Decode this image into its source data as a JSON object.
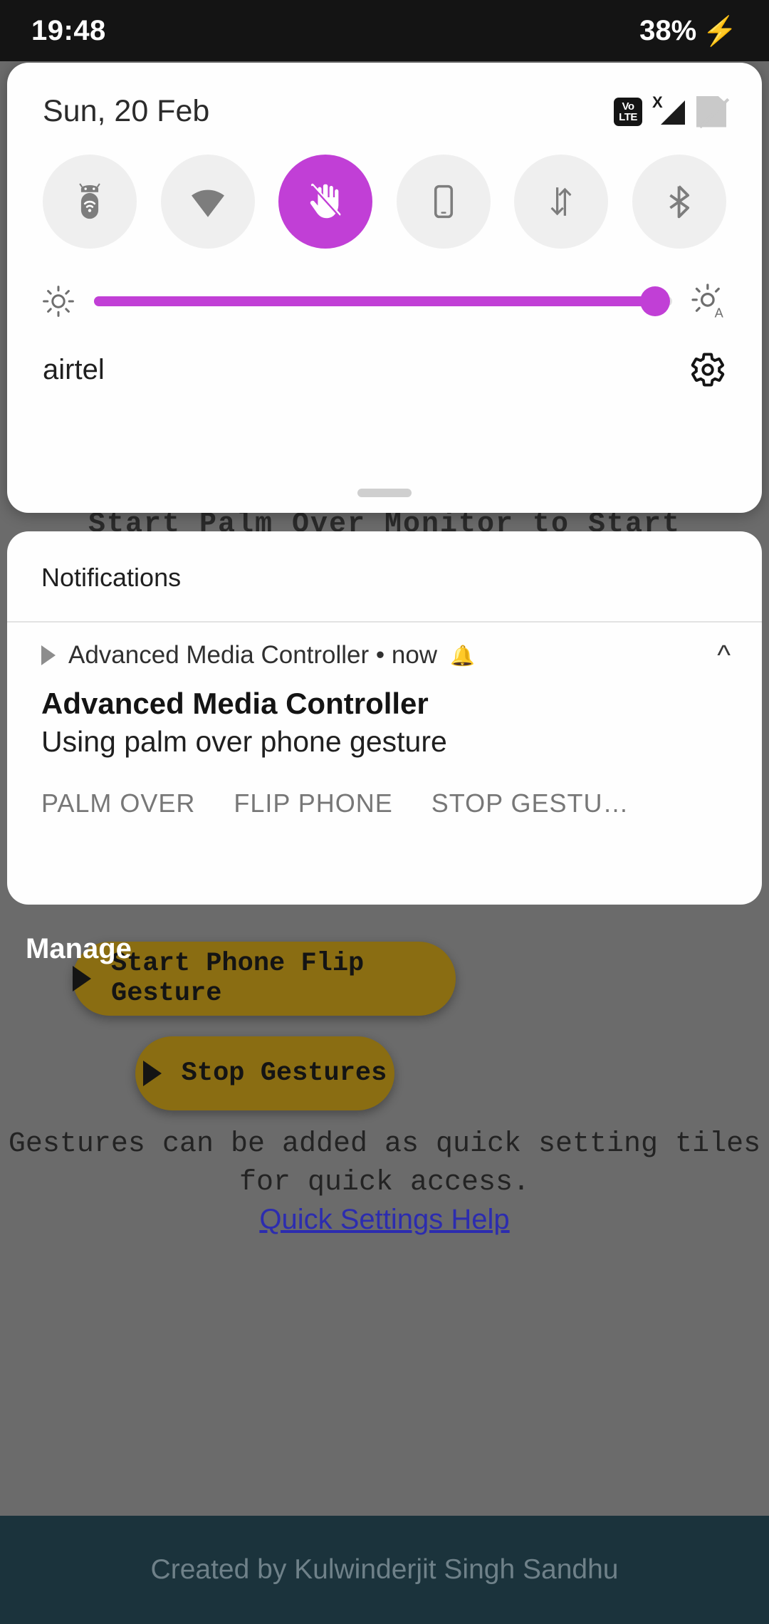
{
  "status_bar": {
    "time": "19:48",
    "battery_percent": "38%",
    "charging_icon": "bolt-icon"
  },
  "quick_settings": {
    "date": "Sun, 20 Feb",
    "status_icons": [
      {
        "name": "volte-icon",
        "top": "Vo",
        "bottom": "LTE"
      },
      {
        "name": "signal-x-icon",
        "label": "X"
      },
      {
        "name": "sim-disabled-icon",
        "label": ""
      }
    ],
    "tiles": [
      {
        "name": "android-hotspot-tile",
        "label": "Android Auto",
        "active": false
      },
      {
        "name": "wifi-tile",
        "label": "Wi-Fi",
        "active": false
      },
      {
        "name": "palm-gesture-tile",
        "label": "Palm Over",
        "active": true
      },
      {
        "name": "device-tile",
        "label": "Device",
        "active": false
      },
      {
        "name": "mobile-data-tile",
        "label": "Mobile data",
        "active": false
      },
      {
        "name": "bluetooth-tile",
        "label": "Bluetooth",
        "active": false
      }
    ],
    "brightness": {
      "value_percent": 97,
      "low_icon": "brightness-low-icon",
      "auto_icon": "brightness-auto-icon"
    },
    "carrier": "airtel",
    "settings_icon": "gear-icon",
    "accent_color": "#c13fd6"
  },
  "notifications": {
    "header": "Notifications",
    "manage_label": "Manage",
    "items": [
      {
        "app_line": "Advanced Media Controller • now",
        "alert_icon": "bell-icon",
        "collapse_icon": "chevron-up-icon",
        "title": "Advanced Media Controller",
        "text": "Using palm over phone gesture",
        "actions": [
          "PALM OVER",
          "FLIP PHONE",
          "STOP GESTU…"
        ]
      }
    ]
  },
  "background_app": {
    "obscured_line": "Start Palm Over Monitor to Start",
    "buttons": [
      {
        "name": "start-phone-flip-gesture-button",
        "label": "Start Phone Flip Gesture"
      },
      {
        "name": "stop-gestures-button",
        "label": "Stop Gestures"
      }
    ],
    "note": "Gestures can be added as quick setting tiles for quick access.",
    "help_link": "Quick Settings Help",
    "footer": "Created by Kulwinderjit Singh Sandhu",
    "button_color": "#8a6d12",
    "footer_color": "#1b333c",
    "link_color": "#2c2caf"
  }
}
